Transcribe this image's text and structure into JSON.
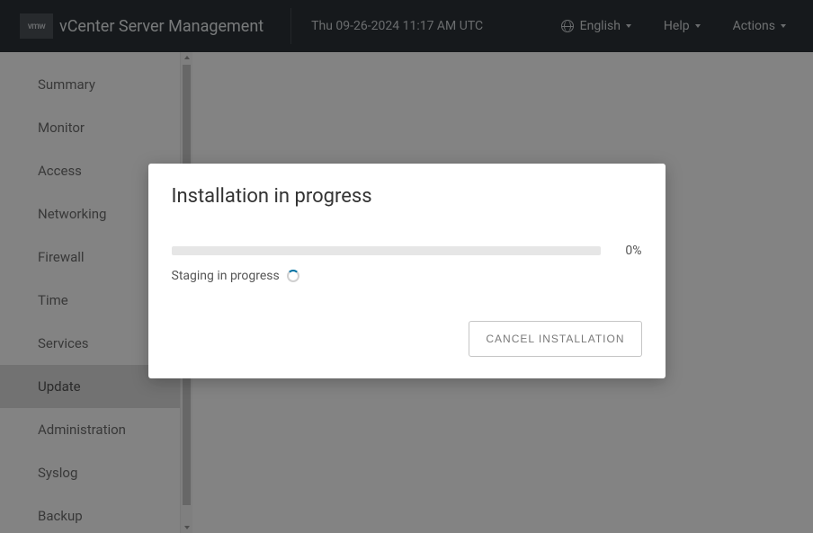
{
  "header": {
    "logo_text": "vmw",
    "app_title": "vCenter Server Management",
    "datetime": "Thu 09-26-2024 11:17 AM UTC",
    "language": "English",
    "help": "Help",
    "actions": "Actions"
  },
  "sidebar": {
    "items": [
      {
        "label": "Summary",
        "active": false
      },
      {
        "label": "Monitor",
        "active": false
      },
      {
        "label": "Access",
        "active": false
      },
      {
        "label": "Networking",
        "active": false
      },
      {
        "label": "Firewall",
        "active": false
      },
      {
        "label": "Time",
        "active": false
      },
      {
        "label": "Services",
        "active": false
      },
      {
        "label": "Update",
        "active": true
      },
      {
        "label": "Administration",
        "active": false
      },
      {
        "label": "Syslog",
        "active": false
      },
      {
        "label": "Backup",
        "active": false
      }
    ]
  },
  "modal": {
    "title": "Installation in progress",
    "percent": "0%",
    "status": "Staging in progress",
    "cancel_label": "CANCEL INSTALLATION"
  }
}
